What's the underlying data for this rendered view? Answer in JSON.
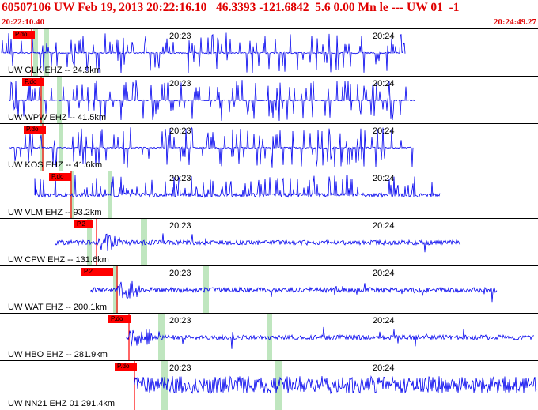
{
  "header": {
    "title": "60507106 UW Feb 19, 2013 20:22:16.10   46.3393 -121.6842  5.6 0.00 Mn le --- UW 01  -1",
    "start_time": "20:22:10.40",
    "end_time": "20:24:49.27"
  },
  "colors": {
    "trace": "#0000ee",
    "pick": "#ff0000",
    "header_text": "#e00000",
    "window_marker": "#bfe6bf"
  },
  "tick_labels": [
    "20:23",
    "20:24"
  ],
  "traces": [
    {
      "label": "UW GLK EHZ -- 24.9km",
      "pick": "P.do",
      "style": "spiky"
    },
    {
      "label": "UW WPW EHZ -- 41.5km",
      "pick": "P.do",
      "style": "spiky"
    },
    {
      "label": "UW KOS EHZ -- 41.6km",
      "pick": "P.do",
      "style": "spiky"
    },
    {
      "label": "UW VLM EHZ -- 93.2km",
      "pick": "P.do",
      "style": "medium"
    },
    {
      "label": "UW CPW EHZ -- 131.6km",
      "pick": "P.2",
      "style": "noise"
    },
    {
      "label": "UW WAT EHZ -- 200.1km",
      "pick": "P.2",
      "style": "noise"
    },
    {
      "label": "UW HBO EHZ -- 281.9km",
      "pick": "P.do",
      "style": "noise"
    },
    {
      "label": "UW NN21 EHZ 01 291.4km",
      "pick": "P.do",
      "style": "dense"
    }
  ]
}
